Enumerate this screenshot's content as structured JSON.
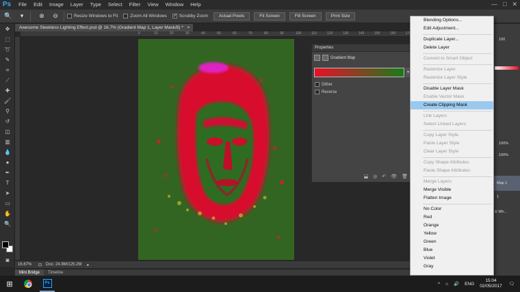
{
  "menubar": {
    "logo": "Ps",
    "items": [
      "File",
      "Edit",
      "Image",
      "Layer",
      "Type",
      "Select",
      "Filter",
      "View",
      "Window",
      "Help"
    ],
    "minimize": "—",
    "maximize": "□",
    "close": "✕"
  },
  "options": {
    "resize_windows": "Resize Windows to Fit",
    "zoom_all": "Zoom All Windows",
    "scrubby": "Scrubby Zoom",
    "actual_pixels": "Actual Pixels",
    "fit_screen": "Fit Screen",
    "fill_screen": "Fill Screen",
    "print_size": "Print Size"
  },
  "document": {
    "tab_title": "Awesome Sleekless Lighting Effect.psd @ 16.7% (Gradient Map 1, Layer Mask/8) *",
    "tab_close": "×",
    "zoom": "16.67%",
    "doc_size": "Doc: 24.9M/125.2M",
    "ruler_marks": [
      "0",
      "10",
      "20",
      "30",
      "40",
      "50",
      "60",
      "70",
      "80",
      "90",
      "100",
      "110",
      "120",
      "130",
      "140",
      "150",
      "160",
      "170"
    ]
  },
  "bottom_tabs": [
    "Mini Bridge",
    "Timeline"
  ],
  "properties": {
    "header": "Properties",
    "title": "Gradient Map",
    "gradient_colors": [
      "#e8102a",
      "#1a7a1a"
    ],
    "dither": "Dither",
    "reverse": "Reverse"
  },
  "context_menu": [
    {
      "label": "Blending Options...",
      "enabled": true
    },
    {
      "label": "Edit Adjustment...",
      "enabled": true
    },
    {
      "sep": true
    },
    {
      "label": "Duplicate Layer...",
      "enabled": true
    },
    {
      "label": "Delete Layer",
      "enabled": true
    },
    {
      "sep": true
    },
    {
      "label": "Convert to Smart Object",
      "enabled": false
    },
    {
      "sep": true
    },
    {
      "label": "Rasterize Layer",
      "enabled": false
    },
    {
      "label": "Rasterize Layer Style",
      "enabled": false
    },
    {
      "sep": true
    },
    {
      "label": "Disable Layer Mask",
      "enabled": true
    },
    {
      "label": "Enable Vector Mask",
      "enabled": false
    },
    {
      "label": "Create Clipping Mask",
      "enabled": true,
      "highlighted": true
    },
    {
      "sep": true
    },
    {
      "label": "Link Layers",
      "enabled": false
    },
    {
      "label": "Select Linked Layers",
      "enabled": false
    },
    {
      "sep": true
    },
    {
      "label": "Copy Layer Style",
      "enabled": false
    },
    {
      "label": "Paste Layer Style",
      "enabled": false
    },
    {
      "label": "Clear Layer Style",
      "enabled": false
    },
    {
      "sep": true
    },
    {
      "label": "Copy Shape Attributes",
      "enabled": false
    },
    {
      "label": "Paste Shape Attributes",
      "enabled": false
    },
    {
      "sep": true
    },
    {
      "label": "Merge Layers",
      "enabled": false
    },
    {
      "label": "Merge Visible",
      "enabled": true
    },
    {
      "label": "Flatten Image",
      "enabled": true
    },
    {
      "sep": true
    },
    {
      "label": "No Color",
      "enabled": true
    },
    {
      "label": "Red",
      "enabled": true
    },
    {
      "label": "Orange",
      "enabled": true
    },
    {
      "label": "Yellow",
      "enabled": true
    },
    {
      "label": "Green",
      "enabled": true
    },
    {
      "label": "Blue",
      "enabled": true
    },
    {
      "label": "Violet",
      "enabled": true
    },
    {
      "label": "Gray",
      "enabled": true
    }
  ],
  "dock": {
    "pct_top": "100",
    "pct1": "100%",
    "pct2": "100%",
    "layer_name": "Map 1",
    "frag1": "1",
    "frag2": "& Wh..."
  },
  "taskbar": {
    "lang": "ENG",
    "time": "15:04",
    "date": "02/05/2017",
    "ps_label": "Ps"
  }
}
